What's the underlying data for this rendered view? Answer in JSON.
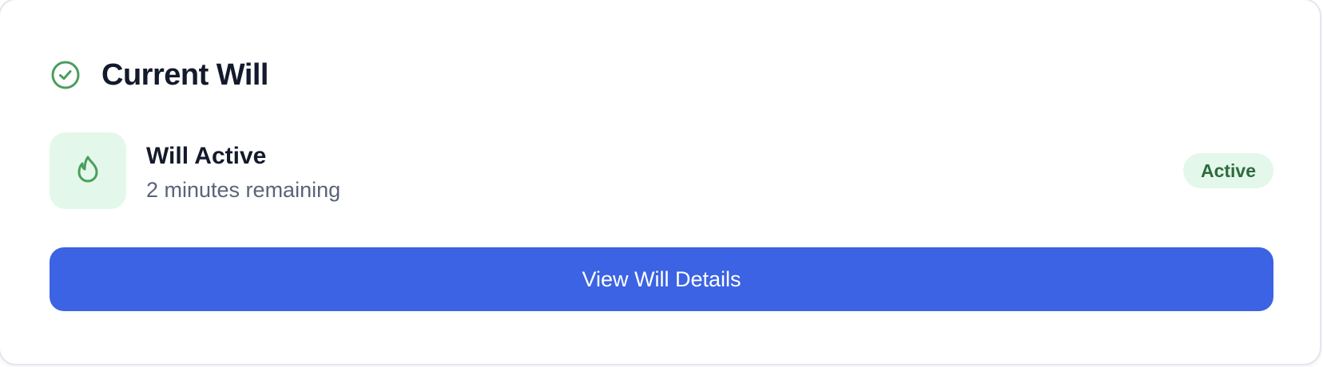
{
  "card": {
    "title": "Current Will",
    "title_icon": "check-circle-icon",
    "status": {
      "icon": "flame-icon",
      "title": "Will Active",
      "subtitle": "2 minutes remaining",
      "badge": "Active"
    },
    "action_label": "View Will Details"
  },
  "colors": {
    "accent_green": "#4a9e5c",
    "green_bg": "#e3f8ea",
    "badge_text": "#2f6a3d",
    "primary_button": "#3b63e3",
    "heading_text": "#131a2b",
    "muted_text": "#5a6478"
  }
}
